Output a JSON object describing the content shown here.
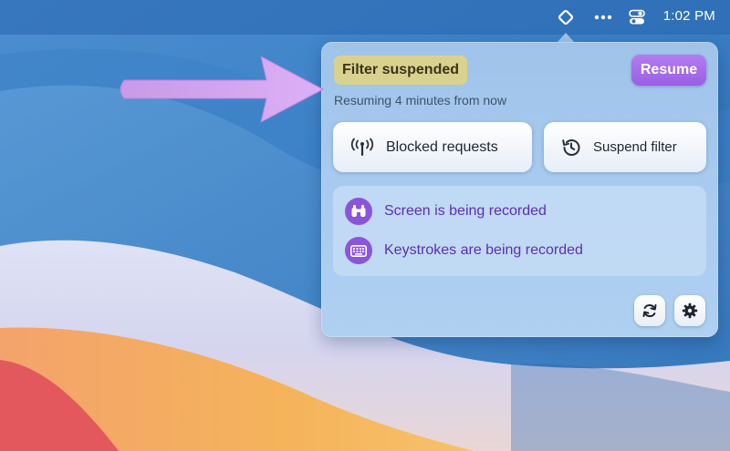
{
  "menubar": {
    "app_icon": "diamond-outline-icon",
    "more_icon": "ellipsis-icon",
    "control_center_icon": "toggles-icon",
    "clock": "1:02 PM"
  },
  "popover": {
    "status": "Filter suspended",
    "resume_label": "Resume",
    "resume_hint": "Resuming 4 minutes from now",
    "actions": [
      {
        "label": "Blocked requests",
        "icon": "antenna-icon"
      },
      {
        "label": "Suspend filter",
        "icon": "history-icon"
      }
    ],
    "recording": [
      {
        "text": "Screen is being recorded",
        "icon": "binoculars-icon"
      },
      {
        "text": "Keystrokes are being recorded",
        "icon": "keyboard-icon"
      }
    ],
    "footer_buttons": {
      "refresh_icon": "refresh-icon",
      "settings_icon": "gear-icon"
    }
  },
  "colors": {
    "accent_purple": "#9a5fe4",
    "status_pill": "#d9d28f",
    "recording_text": "#5a2fb3",
    "callout_arrow": "#d6a6f2"
  }
}
